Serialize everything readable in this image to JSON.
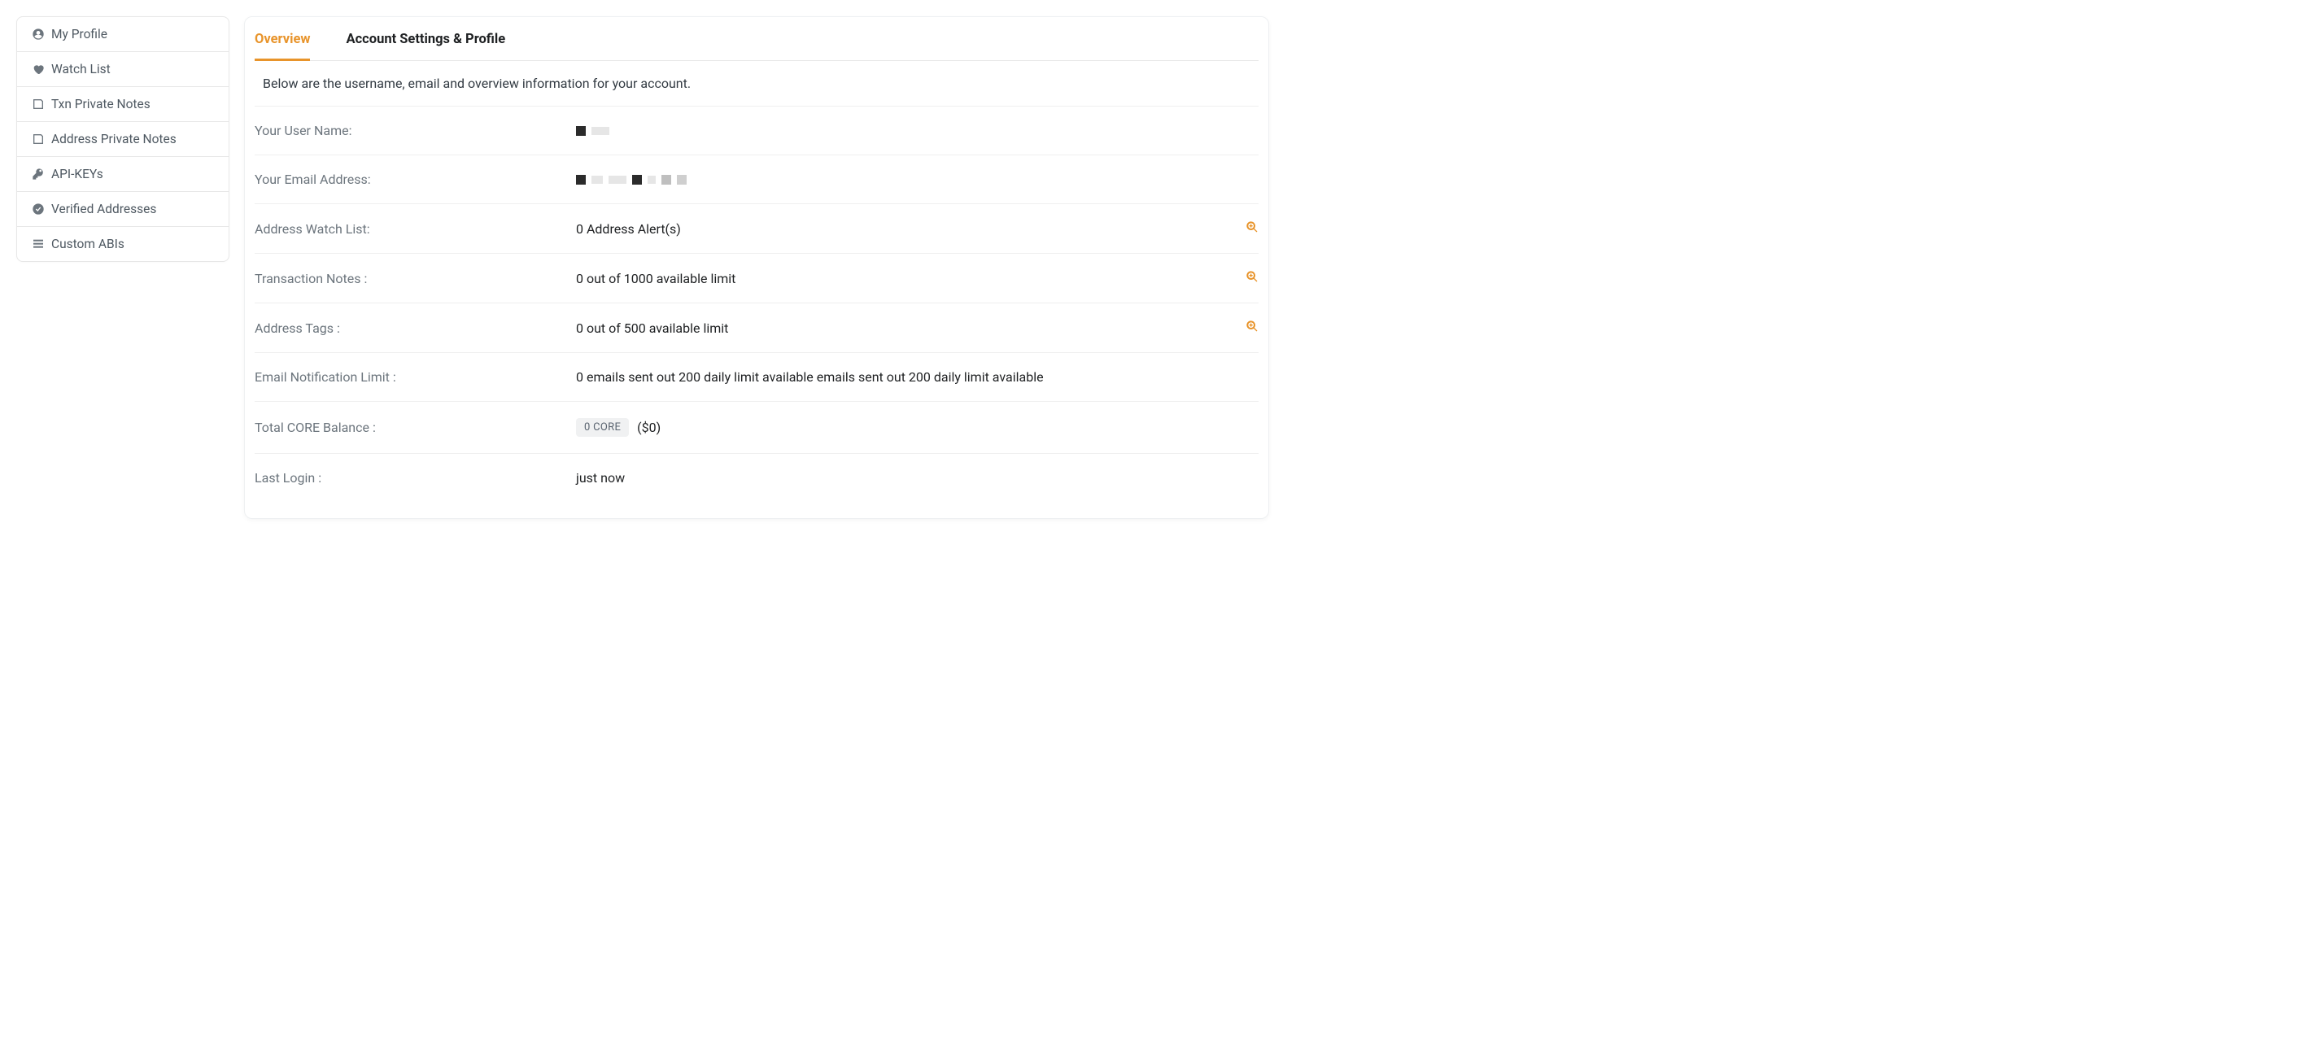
{
  "sidebar": {
    "items": [
      {
        "label": "My Profile",
        "icon": "user-circle-icon"
      },
      {
        "label": "Watch List",
        "icon": "heart-icon"
      },
      {
        "label": "Txn Private Notes",
        "icon": "note-icon"
      },
      {
        "label": "Address Private Notes",
        "icon": "note-icon"
      },
      {
        "label": "API-KEYs",
        "icon": "key-icon"
      },
      {
        "label": "Verified Addresses",
        "icon": "check-badge-icon"
      },
      {
        "label": "Custom ABIs",
        "icon": "stack-icon"
      }
    ]
  },
  "tabs": {
    "overview": "Overview",
    "account_settings": "Account Settings & Profile"
  },
  "intro": "Below are the username, email and overview information for your account.",
  "rows": {
    "username_label": "Your User Name:",
    "username_value": "",
    "email_label": "Your Email Address:",
    "email_value": "",
    "watchlist_label": "Address Watch List:",
    "watchlist_value": "0 Address Alert(s)",
    "txnnotes_label": "Transaction Notes :",
    "txnnotes_value": "0 out of 1000 available limit",
    "addrtags_label": "Address Tags :",
    "addrtags_value": "0 out of 500 available limit",
    "emailnotif_label": "Email Notification Limit :",
    "emailnotif_value": "0 emails sent out 200 daily limit available emails sent out 200 daily limit available",
    "balance_label": "Total CORE Balance :",
    "balance_badge": "0 CORE",
    "balance_usd": "($0)",
    "lastlogin_label": "Last Login :",
    "lastlogin_value": "just now"
  }
}
